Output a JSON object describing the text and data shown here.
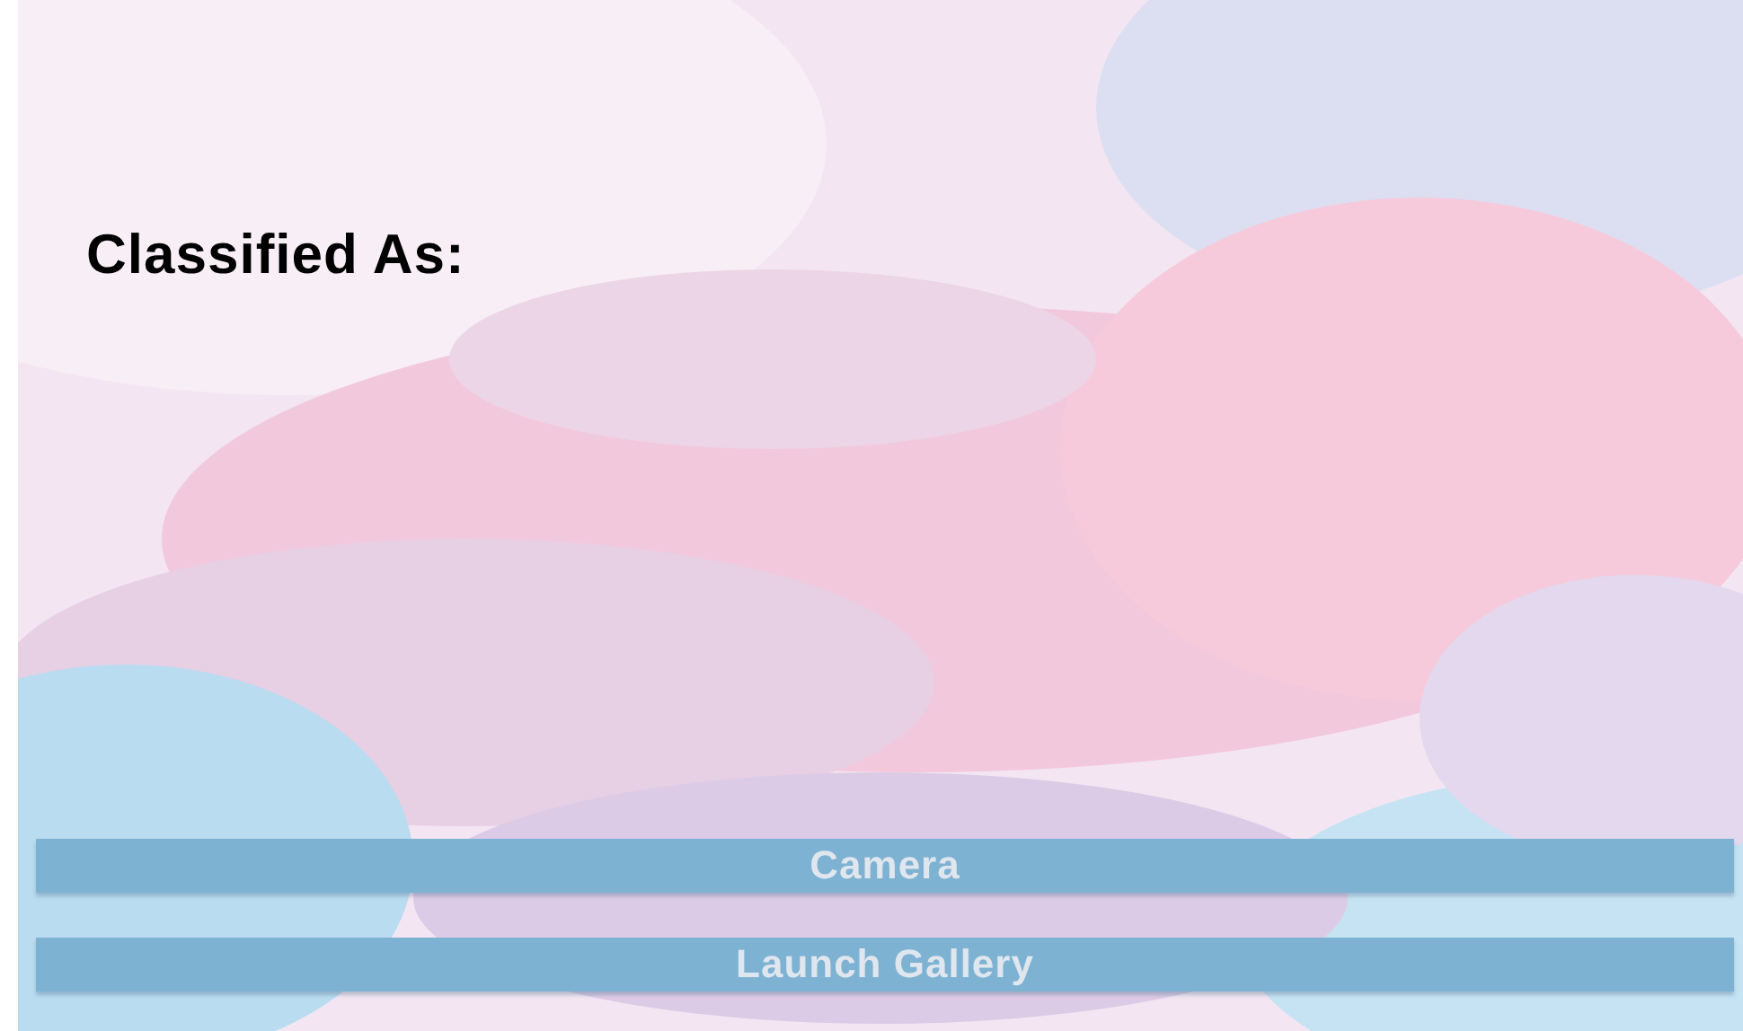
{
  "result_label": "Classified As:",
  "buttons": [
    {
      "label": "Camera"
    },
    {
      "label": "Launch Gallery"
    }
  ]
}
